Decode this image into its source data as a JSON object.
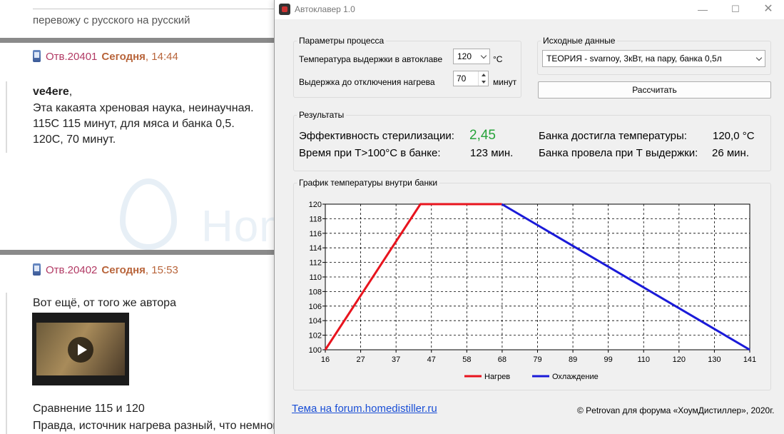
{
  "forum": {
    "top_text": "перевожу с русского на русский",
    "post1": {
      "num": "Отв.20401",
      "today": "Сегодня",
      "time": ", 14:44",
      "author": "ve4ere",
      "author_suffix": ",",
      "line1": "Эта какаята хреновая наука, неинаучная.",
      "line2": "115C 115 минут, для мяса и банка 0,5.",
      "line3": "120С, 70 минут."
    },
    "watermark": "HomeDistiller.ru",
    "post2": {
      "num": "Отв.20402",
      "today": "Сегодня",
      "time": ", 15:53",
      "line1": "Вот ещё, от того же автора",
      "line2": "Сравнение 115 и 120",
      "line3": "Правда, источник нагрева разный, что немного путает"
    }
  },
  "app": {
    "title": "Автоклавер 1.0",
    "params": {
      "legend": "Параметры процесса",
      "temp_label": "Температура выдержки в автоклаве",
      "temp_value": "120",
      "temp_unit": "°С",
      "hold_label": "Выдержка до отключения нагрева",
      "hold_value": "70",
      "hold_unit": "минут"
    },
    "source": {
      "legend": "Исходные данные",
      "selected": "ТЕОРИЯ - svarnoy, 3кВт, на пару, банка 0,5л",
      "calc_button": "Рассчитать"
    },
    "results": {
      "legend": "Результаты",
      "eff_label": "Эффективность стерилизации:",
      "eff_value": "2,45",
      "time_label": "Время при Т>100°С в банке:",
      "time_value": "123 мин.",
      "reached_label": "Банка достигла температуры:",
      "reached_value": "120,0 °С",
      "held_label": "Банка провела при Т выдержки:",
      "held_value": "26 мин."
    },
    "chart_legend": "График температуры внутри банки",
    "link": "Тема на forum.homedistiller.ru",
    "copyright": "© Petrovan для форума «ХоумДистиллер», 2020г.",
    "colors": {
      "heating": "#e8141e",
      "cooling": "#1a1ad8",
      "eff_value": "#26a33a"
    }
  },
  "chart_data": {
    "type": "line",
    "x_ticks": [
      "16",
      "27",
      "37",
      "47",
      "58",
      "68",
      "79",
      "89",
      "99",
      "110",
      "120",
      "130",
      "141"
    ],
    "y_ticks": [
      "100",
      "102",
      "104",
      "106",
      "108",
      "110",
      "112",
      "114",
      "116",
      "118",
      "120"
    ],
    "xlim": [
      16,
      141
    ],
    "ylim": [
      100,
      120
    ],
    "grid": true,
    "legend_position": "bottom",
    "series": [
      {
        "name": "Нагрев",
        "color": "#e8141e",
        "x": [
          16,
          44,
          68
        ],
        "y": [
          100,
          120,
          120
        ]
      },
      {
        "name": "Охлаждение",
        "color": "#1a1ad8",
        "x": [
          68,
          141
        ],
        "y": [
          120,
          100
        ]
      }
    ]
  }
}
